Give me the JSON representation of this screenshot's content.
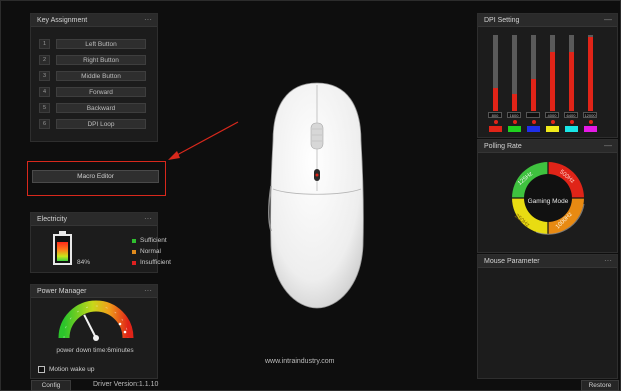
{
  "key_assignment": {
    "title": "Key Assignment",
    "menu": "···",
    "items": [
      {
        "num": "1",
        "label": "Left Button"
      },
      {
        "num": "2",
        "label": "Right Button"
      },
      {
        "num": "3",
        "label": "Middle Button"
      },
      {
        "num": "4",
        "label": "Forward"
      },
      {
        "num": "5",
        "label": "Backward"
      },
      {
        "num": "6",
        "label": "DPI Loop"
      }
    ]
  },
  "macro_editor": {
    "label": "Macro Editor"
  },
  "electricity": {
    "title": "Electricity",
    "menu": "···",
    "percent": "84%",
    "level": 0.84,
    "legend": [
      {
        "label": "Sufficient",
        "color": "#2fbf2f"
      },
      {
        "label": "Normal",
        "color": "#e08a1c"
      },
      {
        "label": "Insufficient",
        "color": "#e02020"
      }
    ]
  },
  "power_manager": {
    "title": "Power Manager",
    "menu": "···",
    "gauge_fraction": 0.35,
    "text": "power down time:6minutes",
    "motion_wake_label": "Motion wake up",
    "motion_wake_checked": false
  },
  "center": {
    "website": "www.intraindustry.com"
  },
  "dpi_setting": {
    "title": "DPI Setting",
    "menu": "—",
    "stages": [
      {
        "value": "800",
        "level": 0.3,
        "color": "#e02418"
      },
      {
        "value": "1600",
        "level": 0.23,
        "color": "#1fd11f"
      },
      {
        "value": "",
        "level": 0.42,
        "color": "#1f2fe8"
      },
      {
        "value": "4000",
        "level": 0.77,
        "color": "#f0ea1a"
      },
      {
        "value": "6400",
        "level": 0.77,
        "color": "#19e6e6"
      },
      {
        "value": "12000",
        "level": 0.97,
        "color": "#e61ae6"
      }
    ]
  },
  "polling_rate": {
    "title": "Polling Rate",
    "menu": "—",
    "center_label": "Gaming Mode",
    "rates": [
      "125Hz",
      "250Hz",
      "500Hz",
      "1000Hz"
    ]
  },
  "mouse_parameter": {
    "title": "Mouse Parameter",
    "menu": "···"
  },
  "footer": {
    "config_label": "Config",
    "driver_version": "Driver Version:1.1.10",
    "restore_label": "Restore"
  }
}
